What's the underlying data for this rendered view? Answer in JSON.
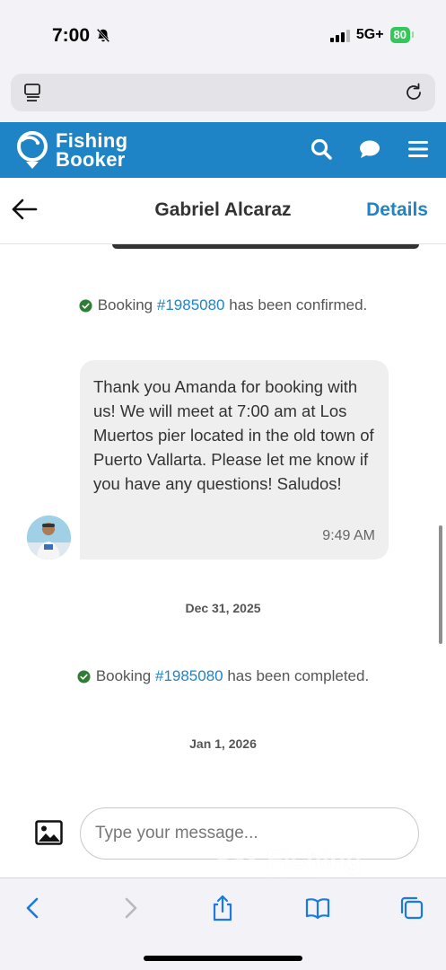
{
  "status_bar": {
    "time": "7:00",
    "network": "5G+",
    "battery": "80"
  },
  "browser": {
    "tabs_icon": "tab-overview-icon",
    "reload_icon": "reload-icon"
  },
  "header": {
    "logo_line1": "Fishing",
    "logo_line2": "Booker",
    "icons": [
      "search-icon",
      "chat-icon",
      "menu-icon"
    ],
    "brand_color": "#1f84c6"
  },
  "conversation": {
    "back_icon": "back-arrow-icon",
    "title": "Gabriel Alcaraz",
    "details_label": "Details"
  },
  "messages": {
    "system_confirmed": {
      "prefix": "Booking ",
      "booking_id": "#1985080",
      "suffix": " has been confirmed."
    },
    "bubble": {
      "text": "Thank you Amanda for booking with us! We will meet at 7:00 am at Los Muertos pier located in the old town of Puerto Vallarta. Please let me know if you have any questions! Saludos!",
      "time": "9:49 AM"
    },
    "date_1": "Dec 31, 2025",
    "system_completed": {
      "prefix": "Booking ",
      "booking_id": "#1985080",
      "suffix": " has been completed."
    },
    "date_2": "Jan 1, 2026"
  },
  "composer": {
    "placeholder": "Type your message..."
  },
  "watermark": {
    "line1": "Fishing",
    "line2": "Booker"
  },
  "toolbar": {
    "icons": [
      "back-icon",
      "forward-icon",
      "share-icon",
      "bookmarks-icon",
      "tabs-icon"
    ]
  }
}
